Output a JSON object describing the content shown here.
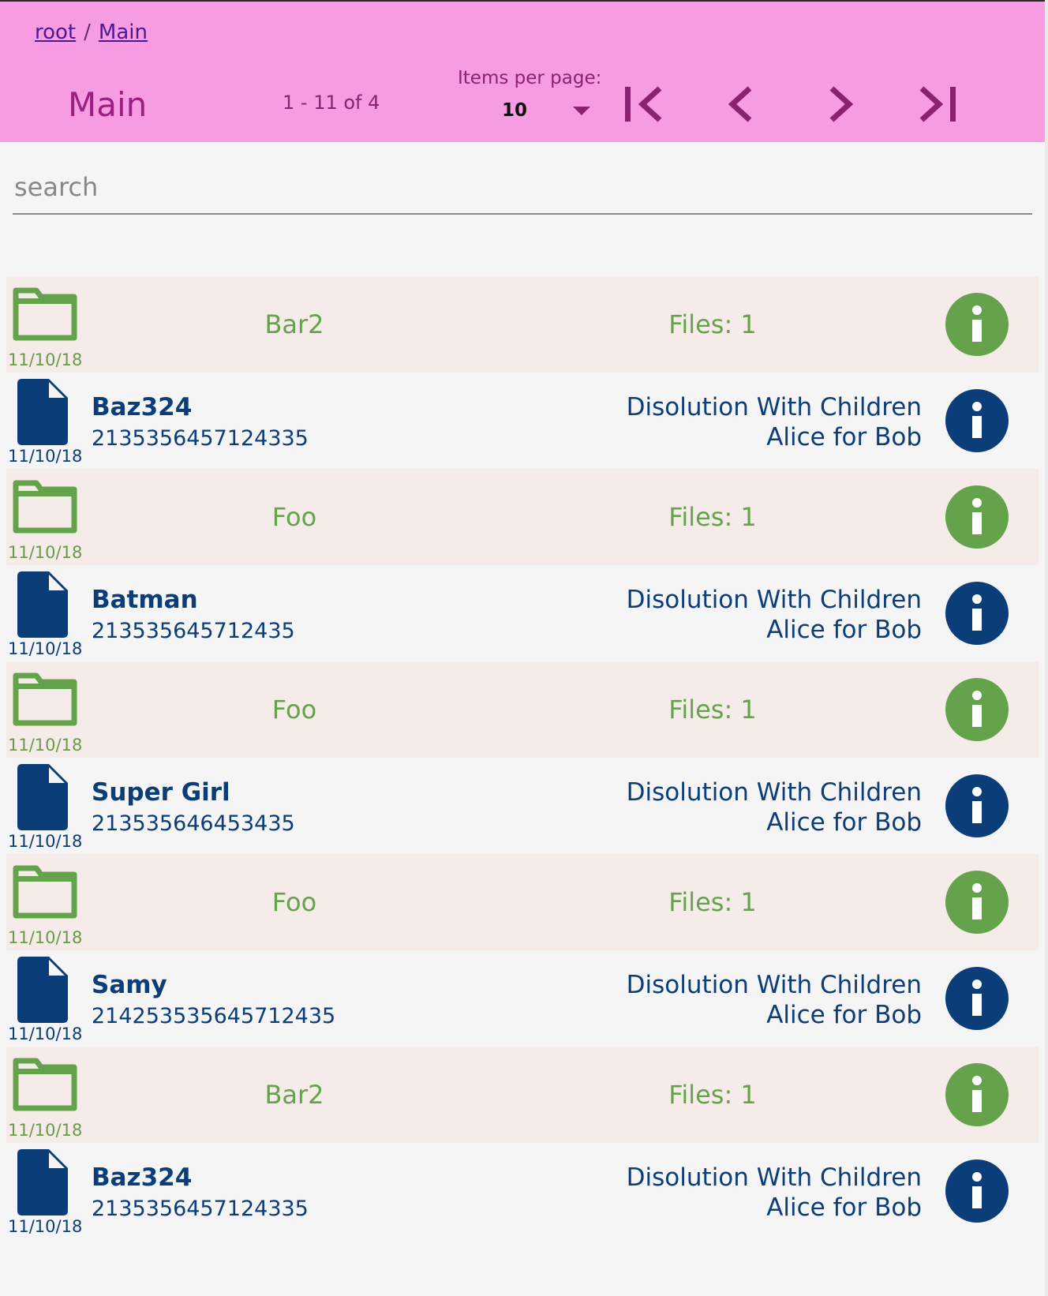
{
  "breadcrumb": {
    "root": "root",
    "separator": "/",
    "current": "Main"
  },
  "header": {
    "title": "Main",
    "range": "1 - 11 of 4",
    "items_per_page_label": "Items per page:",
    "items_per_page_value": "10"
  },
  "pager": {
    "first_icon": "first-page-icon",
    "prev_icon": "chevron-left-icon",
    "next_icon": "chevron-right-icon",
    "last_icon": "last-page-icon"
  },
  "search": {
    "placeholder": "search",
    "value": ""
  },
  "colors": {
    "header_bg": "#f79be2",
    "folder_green": "#65a24c",
    "file_blue": "#0b3d78",
    "folder_row_bg": "#f5ebe9"
  },
  "rows": [
    {
      "kind": "folder",
      "icon": "folder-icon",
      "date": "11/10/18",
      "name": "Bar2",
      "count": "Files: 1"
    },
    {
      "kind": "file",
      "icon": "document-icon",
      "date": "11/10/18",
      "name": "Baz324",
      "number": "2135356457124335",
      "line1": "Disolution With Children",
      "line2": "Alice for Bob"
    },
    {
      "kind": "folder",
      "icon": "folder-icon",
      "date": "11/10/18",
      "name": "Foo",
      "count": "Files: 1"
    },
    {
      "kind": "file",
      "icon": "document-icon",
      "date": "11/10/18",
      "name": "Batman",
      "number": "213535645712435",
      "line1": "Disolution With Children",
      "line2": "Alice for Bob"
    },
    {
      "kind": "folder",
      "icon": "folder-icon",
      "date": "11/10/18",
      "name": "Foo",
      "count": "Files: 1"
    },
    {
      "kind": "file",
      "icon": "document-icon",
      "date": "11/10/18",
      "name": "Super Girl",
      "number": "213535646453435",
      "line1": "Disolution With Children",
      "line2": "Alice for Bob"
    },
    {
      "kind": "folder",
      "icon": "folder-icon",
      "date": "11/10/18",
      "name": "Foo",
      "count": "Files: 1"
    },
    {
      "kind": "file",
      "icon": "document-icon",
      "date": "11/10/18",
      "name": "Samy",
      "number": "214253535645712435",
      "line1": "Disolution With Children",
      "line2": "Alice for Bob"
    },
    {
      "kind": "folder",
      "icon": "folder-icon",
      "date": "11/10/18",
      "name": "Bar2",
      "count": "Files: 1"
    },
    {
      "kind": "file",
      "icon": "document-icon",
      "date": "11/10/18",
      "name": "Baz324",
      "number": "2135356457124335",
      "line1": "Disolution With Children",
      "line2": "Alice for Bob"
    }
  ]
}
